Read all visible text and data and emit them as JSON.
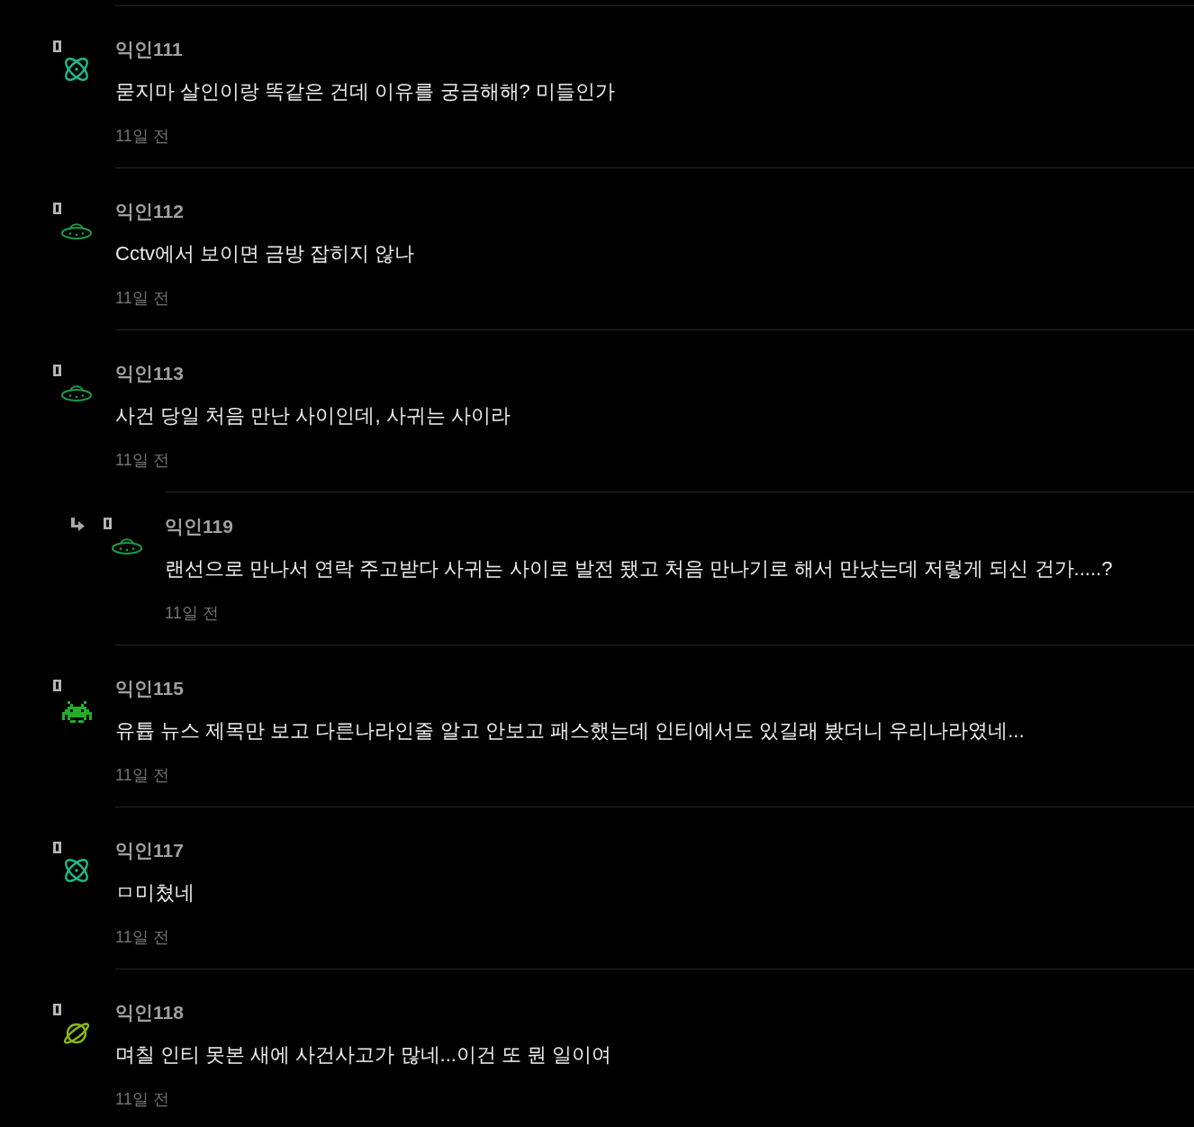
{
  "comments": [
    {
      "author": "익인111",
      "avatar": {
        "kind": "atom"
      },
      "text": "묻지마 살인이랑 똑같은 건데 이유를 궁금해해? 미들인가",
      "time": "11일 전",
      "reply": false
    },
    {
      "author": "익인112",
      "avatar": {
        "kind": "ufo"
      },
      "text": "Cctv에서 보이면 금방 잡히지 않나",
      "time": "11일 전",
      "reply": false
    },
    {
      "author": "익인113",
      "avatar": {
        "kind": "ufo"
      },
      "text": "사건 당일 처음 만난 사이인데, 사귀는 사이라",
      "time": "11일 전",
      "reply": false
    },
    {
      "author": "익인119",
      "avatar": {
        "kind": "ufo"
      },
      "text": "랜선으로 만나서 연락 주고받다 사귀는 사이로 발전 됐고 처음 만나기로 해서 만났는데 저렇게 되신 건가.....?",
      "time": "11일 전",
      "reply": true
    },
    {
      "author": "익인115",
      "avatar": {
        "kind": "invader"
      },
      "text": "유튭 뉴스 제목만 보고 다른나라인줄 알고 안보고 패스했는데 인티에서도 있길래 봤더니 우리나라였네...",
      "time": "11일 전",
      "reply": false
    },
    {
      "author": "익인117",
      "avatar": {
        "kind": "atom"
      },
      "text": "ㅁ미쳤네",
      "time": "11일 전",
      "reply": false
    },
    {
      "author": "익인118",
      "avatar": {
        "kind": "planet"
      },
      "text": "며칠 인티 못본 새에 사건사고가 많네...이건 또 뭔 일이여",
      "time": "11일 전",
      "reply": false
    }
  ]
}
